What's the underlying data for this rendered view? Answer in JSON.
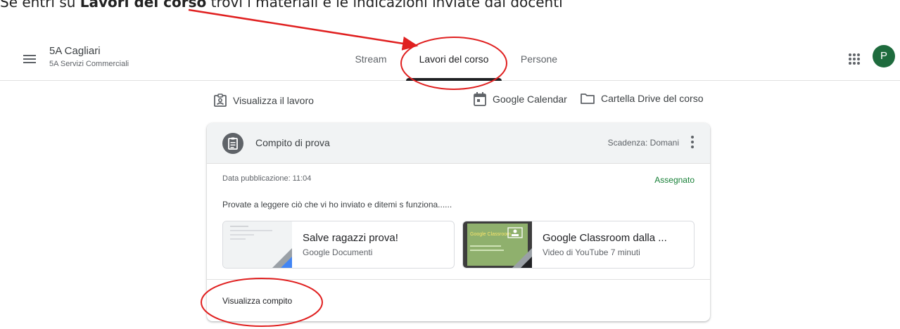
{
  "caption": {
    "prefix": "Se entri su ",
    "bold": "Lavori del corso",
    "suffix": " trovi i materiali e le indicazioni inviate dai docenti"
  },
  "header": {
    "class_name": "5A Cagliari",
    "class_section": "5A Servizi Commerciali",
    "avatar_letter": "P",
    "avatar_color": "#1e6b3d",
    "tabs": [
      {
        "label": "Stream",
        "active": false
      },
      {
        "label": "Lavori del corso",
        "active": true
      },
      {
        "label": "Persone",
        "active": false
      }
    ]
  },
  "actions": {
    "view_work": "Visualizza il lavoro",
    "calendar": "Google Calendar",
    "drive": "Cartella Drive del corso"
  },
  "assignment": {
    "title": "Compito di prova",
    "due": "Scadenza: Domani",
    "published": "Data pubblicazione: 11:04",
    "status": "Assegnato",
    "status_color": "#188038",
    "instructions": "Provate a leggere ciò che vi ho inviato e ditemi s funziona......",
    "attachments": [
      {
        "title": "Salve ragazzi prova!",
        "subtitle": "Google Documenti",
        "icon": "google-docs-icon"
      },
      {
        "title": "Google Classroom dalla ...",
        "subtitle": "Video di YouTube  7 minuti",
        "icon": "youtube-video-icon",
        "thumb_text": "Google Classroom"
      }
    ],
    "view_label": "Visualizza compito"
  },
  "annotation_color": "#e02020"
}
